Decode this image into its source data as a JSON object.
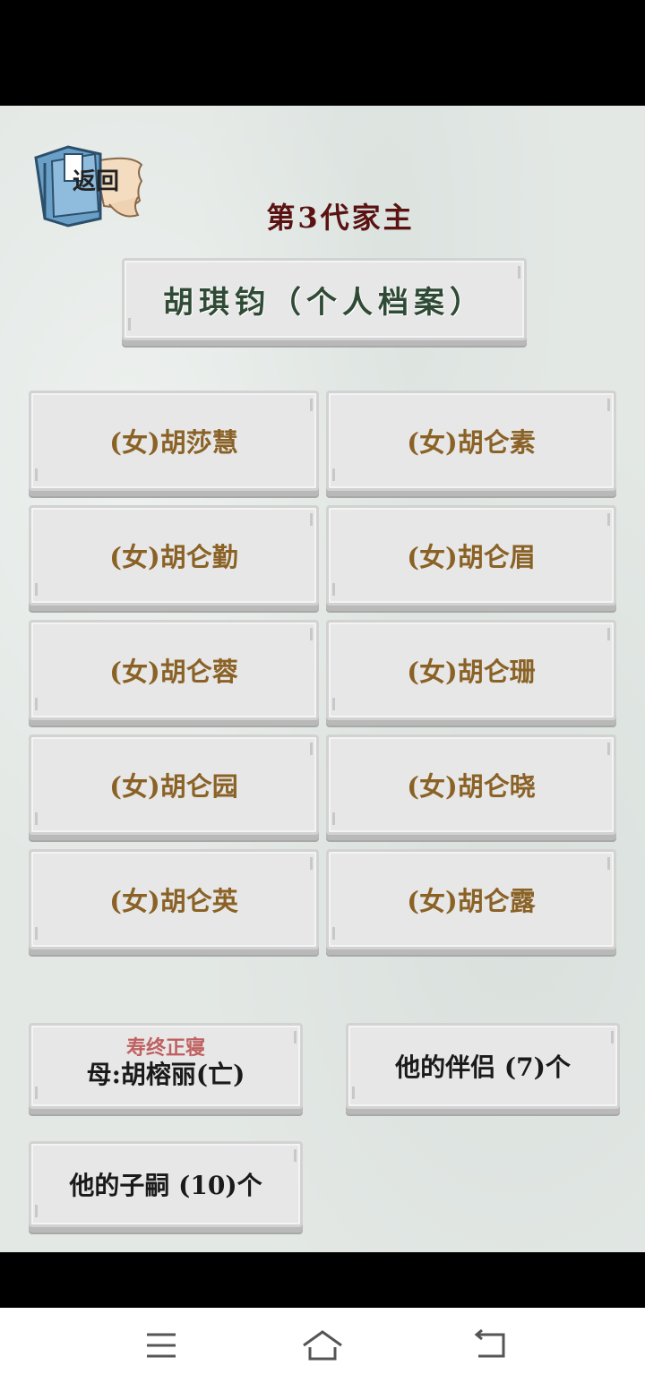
{
  "header": {
    "back_label": "返回",
    "generation_title": "第3代家主"
  },
  "profile": {
    "name_label": "胡琪钧（个人档案）"
  },
  "children": [
    {
      "label": "(女)胡莎慧"
    },
    {
      "label": "(女)胡仑素"
    },
    {
      "label": "(女)胡仑勤"
    },
    {
      "label": "(女)胡仑眉"
    },
    {
      "label": "(女)胡仑蓉"
    },
    {
      "label": "(女)胡仑珊"
    },
    {
      "label": "(女)胡仑园"
    },
    {
      "label": "(女)胡仑晓"
    },
    {
      "label": "(女)胡仑英"
    },
    {
      "label": "(女)胡仑露"
    }
  ],
  "family": {
    "mother_status": "寿终正寝",
    "mother_label": "母:胡榕丽(亡)",
    "partners_label": "他的伴侣 (7)个",
    "heirs_label": "他的子嗣 (10)个"
  },
  "navbar": {
    "icons": [
      "menu-icon",
      "home-icon",
      "back-icon"
    ]
  }
}
